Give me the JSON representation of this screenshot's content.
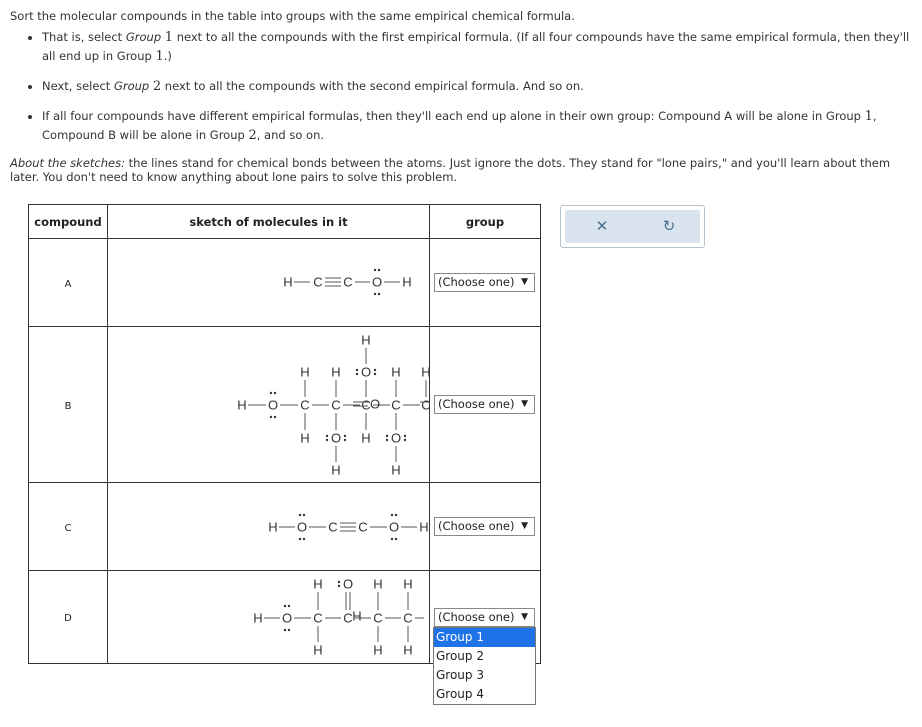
{
  "instructions": {
    "title": "Sort the molecular compounds in the table into groups with the same empirical chemical formula.",
    "bullet1_a": "That is, select ",
    "bullet1_group": "Group",
    "bullet1_num": "1",
    "bullet1_b": " next to all the compounds with the first empirical formula. (If all four compounds have the same empirical formula, then they'll all end up in Group ",
    "bullet1_num2": "1",
    "bullet1_c": ".)",
    "bullet2_a": "Next, select ",
    "bullet2_group": "Group",
    "bullet2_num": "2",
    "bullet2_b": " next to all the compounds with the second empirical formula. And so on.",
    "bullet3_a": "If all four compounds have different empirical formulas, then they'll each end up alone in their own group: Compound A will be alone in Group ",
    "bullet3_num": "1",
    "bullet3_b": ", Compound B will be alone in Group ",
    "bullet3_num2": "2",
    "bullet3_c": ", and so on.",
    "about_label": "About the sketches:",
    "about_text": " the lines stand for chemical bonds between the atoms. Just ignore the dots. They stand for \"lone pairs,\" and you'll learn about them later. You don't need to know anything about lone pairs to solve this problem."
  },
  "table": {
    "headers": {
      "compound": "compound",
      "sketch": "sketch of molecules in it",
      "group": "group"
    },
    "rows": [
      {
        "label": "A",
        "selected": "(Choose one)"
      },
      {
        "label": "B",
        "selected": "(Choose one)"
      },
      {
        "label": "C",
        "selected": "(Choose one)"
      },
      {
        "label": "D",
        "selected": "(Choose one)"
      }
    ]
  },
  "atoms": {
    "H": "H",
    "C": "C",
    "O": "O"
  },
  "dropdown": {
    "options": [
      "Group 1",
      "Group 2",
      "Group 3",
      "Group 4"
    ],
    "highlighted": "Group 1"
  },
  "toolbox": {
    "close_glyph": "✕",
    "reset_glyph": "↻"
  },
  "colors": {
    "highlight": "#1e73e8",
    "toolbox_bg": "#d9e4ee"
  }
}
